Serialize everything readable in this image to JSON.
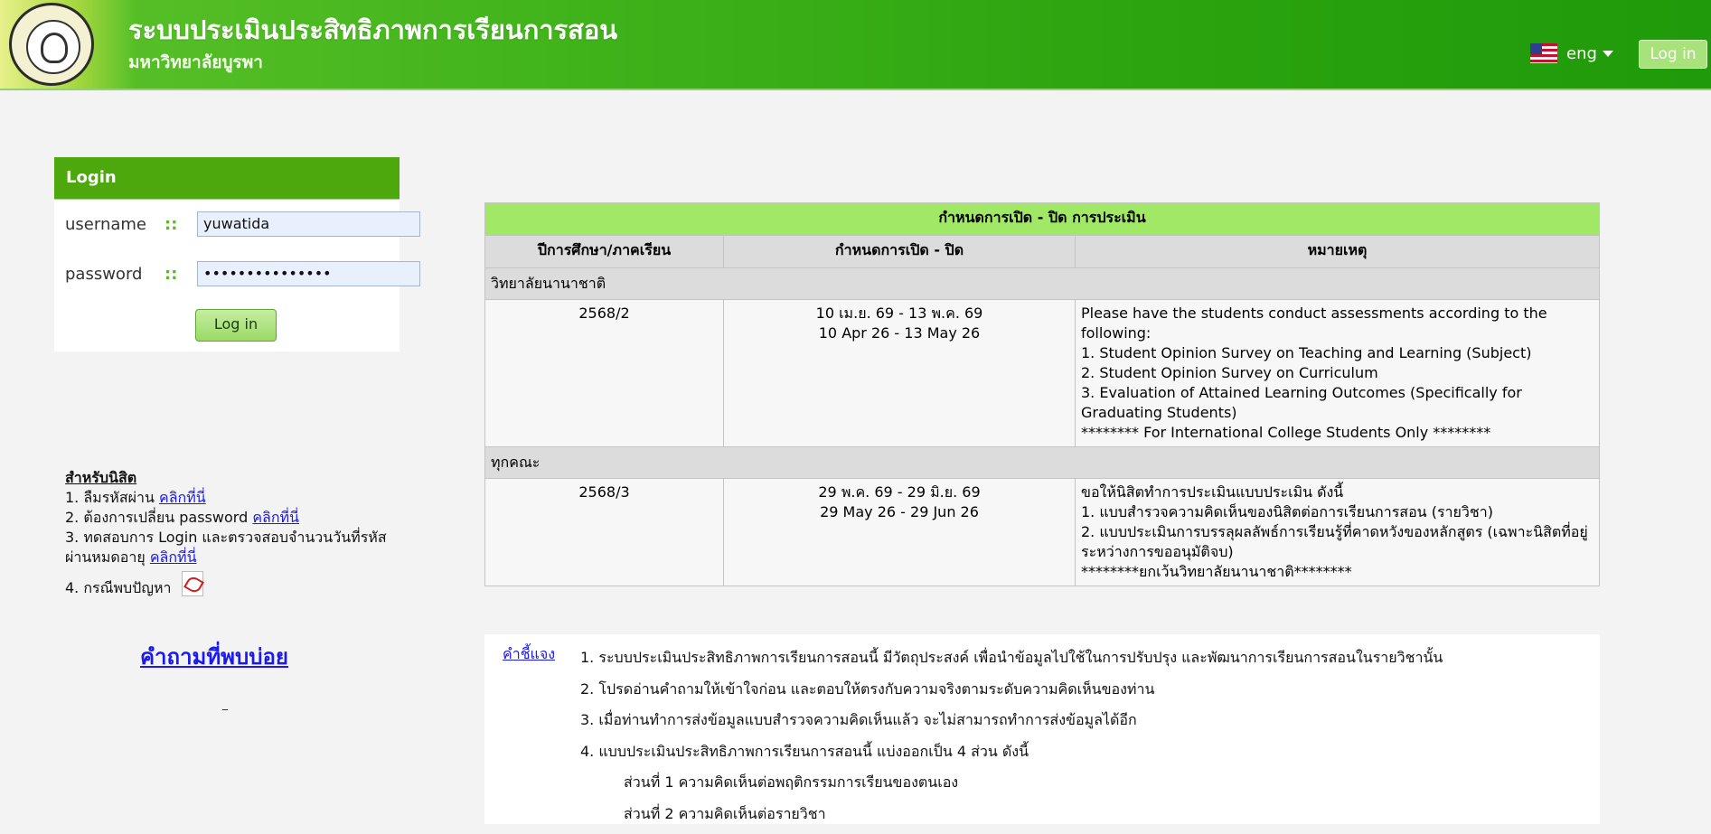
{
  "header": {
    "title": "ระบบประเมินประสิทธิภาพการเรียนการสอน",
    "subtitle": "มหาวิทยาลัยบูรพา",
    "language": "eng",
    "login_button": "Log in"
  },
  "login": {
    "heading": "Login",
    "username_label": "username",
    "username_value": "yuwatida",
    "password_label": "password",
    "password_value": "•••••••••••••••",
    "separator": "::",
    "submit_label": "Log in"
  },
  "student_help": {
    "title": "สำหรับนิสิต",
    "link_text": "คลิกที่นี่",
    "item1": "1. ลืมรหัสผ่าน",
    "item2": "2. ต้องการเปลี่ยน password",
    "item3": "3. ทดสอบการ Login และตรวจสอบจำนวนวันที่รหัสผ่านหมดอายุ",
    "item4": "4. กรณีพบปัญหา"
  },
  "faq_link": "คำถามที่พบบ่อย",
  "schedule": {
    "caption": "กำหนดการเปิด - ปิด การประเมิน",
    "headers": [
      "ปีการศึกษา/ภาคเรียน",
      "กำหนดการเปิด - ปิด",
      "หมายเหตุ"
    ],
    "groups": [
      {
        "name": "วิทยาลัยนานาชาติ",
        "term": "2568/2",
        "dates_th": "10 เม.ย. 69 - 13 พ.ค. 69",
        "dates_en": "10 Apr 26 - 13 May 26",
        "notes": [
          "Please have the students conduct assessments according to the following:",
          "1. Student Opinion Survey on Teaching and Learning (Subject)",
          "2. Student Opinion Survey on Curriculum",
          "3. Evaluation of Attained Learning Outcomes (Specifically for Graduating Students)",
          "******** For International College Students Only ********"
        ]
      },
      {
        "name": "ทุกคณะ",
        "term": "2568/3",
        "dates_th": "29 พ.ค. 69 - 29 มิ.ย. 69",
        "dates_en": "29 May 26 - 29 Jun 26",
        "notes": [
          "ขอให้นิสิตทำการประเมินแบบประเมิน ดังนี้",
          "1. แบบสำรวจความคิดเห็นของนิสิตต่อการเรียนการสอน (รายวิชา)",
          "2. แบบประเมินการบรรลุผลลัพธ์การเรียนรู้ที่คาดหวังของหลักสูตร (เฉพาะนิสิตที่อยู่ระหว่างการขออนุมัติจบ)",
          "********ยกเว้นวิทยาลัยนานาชาติ********"
        ]
      }
    ]
  },
  "explanation": {
    "link": "คำชี้แจง",
    "items": [
      "1. ระบบประเมินประสิทธิภาพการเรียนการสอนนี้ มีวัตถุประสงค์ เพื่อนำข้อมูลไปใช้ในการปรับปรุง และพัฒนาการเรียนการสอนในรายวิชานั้น",
      "2. โปรดอ่านคำถามให้เข้าใจก่อน และตอบให้ตรงกับความจริงตามระดับความคิดเห็นของท่าน",
      "3. เมื่อท่านทำการส่งข้อมูลแบบสำรวจความคิดเห็นแล้ว จะไม่สามารถทำการส่งข้อมูลได้อีก",
      "4. แบบประเมินประสิทธิภาพการเรียนการสอนนี้ แบ่งออกเป็น 4 ส่วน ดังนี้"
    ],
    "subitems": [
      "ส่วนที่ 1 ความคิดเห็นต่อพฤติกรรมการเรียนของตนเอง",
      "ส่วนที่ 2 ความคิดเห็นต่อรายวิชา"
    ]
  }
}
